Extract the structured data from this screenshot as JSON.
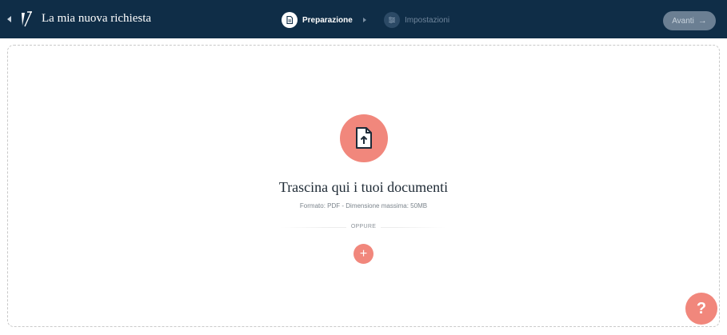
{
  "header": {
    "title": "La mia nuova richiesta",
    "steps": [
      {
        "label": "Preparazione",
        "active": true,
        "icon": "document-icon"
      },
      {
        "label": "Impostazioni",
        "active": false,
        "icon": "sliders-icon"
      }
    ],
    "next_label": "Avanti",
    "next_arrow": "→"
  },
  "dropzone": {
    "title": "Trascina qui i tuoi documenti",
    "subtitle": "Formato: PDF - Dimensione massima: 50MB",
    "or_label": "OPPURE",
    "add_label": "+"
  },
  "help": {
    "label": "?"
  },
  "colors": {
    "navy": "#0f2d47",
    "accent": "#f1877c"
  }
}
